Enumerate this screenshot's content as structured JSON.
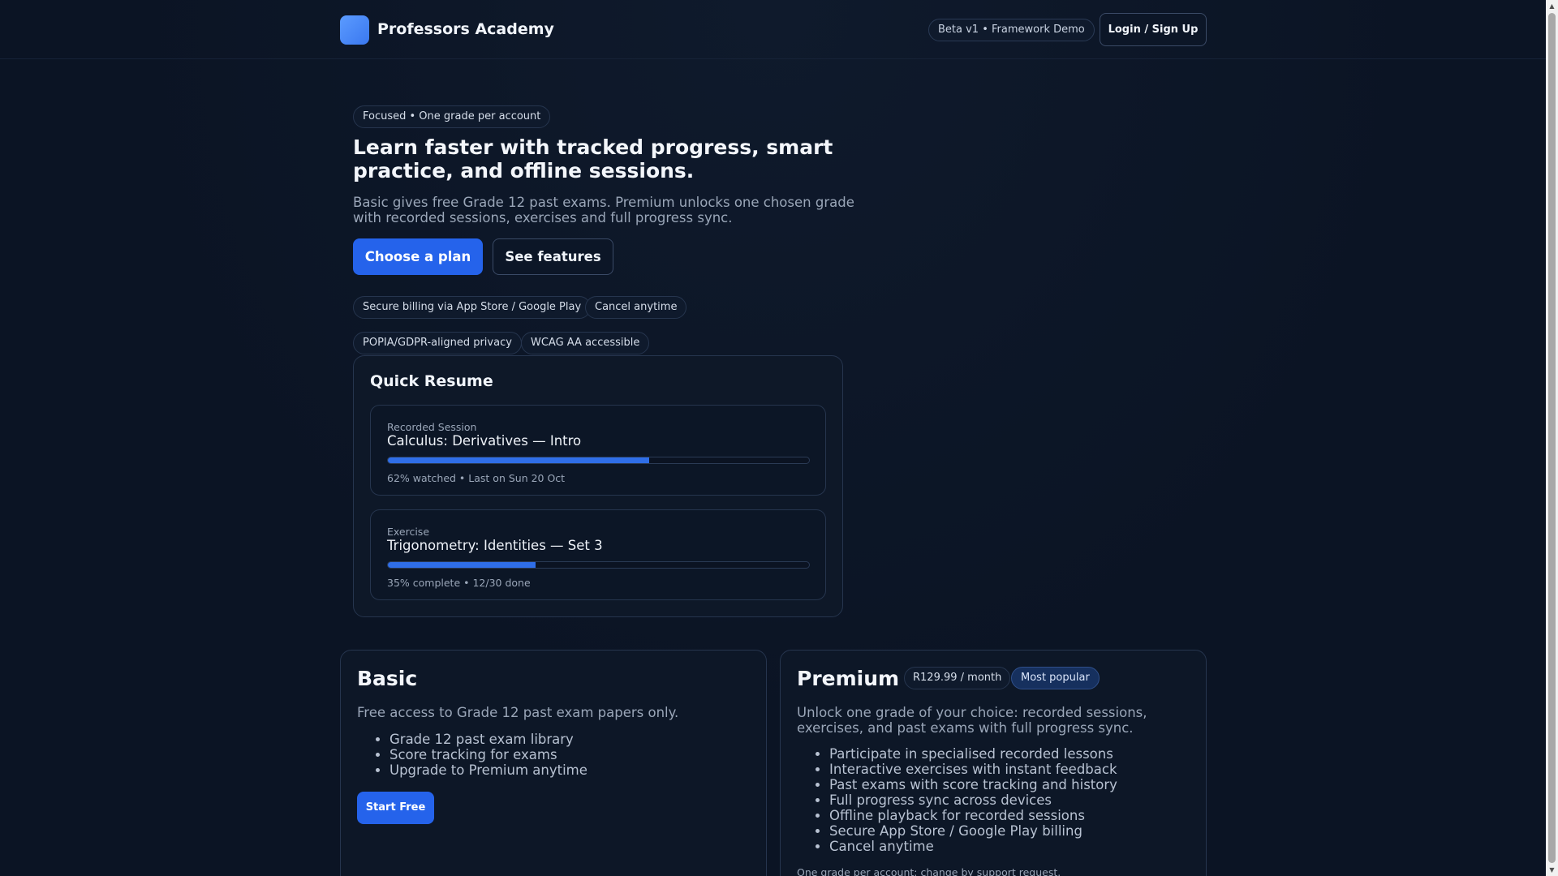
{
  "header": {
    "brand": "Professors Academy",
    "beta_badge": "Beta v1 • Framework Demo",
    "login_label": "Login / Sign Up"
  },
  "hero": {
    "eyebrow": "Focused • One grade per account",
    "title": "Learn faster with tracked progress, smart practice, and offline sessions.",
    "subtitle": "Basic gives free Grade 12 past exams. Premium unlocks one chosen grade with recorded sessions, exercises and full progress sync.",
    "primary_cta": "Choose a plan",
    "secondary_cta": "See features",
    "trust_pills": [
      "Secure billing via App Store / Google Play",
      "Cancel anytime",
      "POPIA/GDPR-aligned privacy",
      "WCAG AA accessible"
    ]
  },
  "quick_resume": {
    "title": "Quick Resume",
    "items": [
      {
        "kind": "Recorded Session",
        "name": "Calculus: Derivatives — Intro",
        "progress": 0.62,
        "meta": "62% watched • Last on Sun 20 Oct"
      },
      {
        "kind": "Exercise",
        "name": "Trigonometry: Identities — Set 3",
        "progress": 0.35,
        "meta": "35% complete • 12/30 done"
      }
    ]
  },
  "plans": {
    "basic": {
      "name": "Basic",
      "description": "Free access to Grade 12 past exam papers only.",
      "features": [
        "Grade 12 past exam library",
        "Score tracking for exams",
        "Upgrade to Premium anytime"
      ],
      "cta": "Start Free"
    },
    "premium": {
      "name": "Premium",
      "price": "R129.99 / month",
      "badge": "Most popular",
      "description": "Unlock one grade of your choice: recorded sessions, exercises, and past exams with full progress sync.",
      "features": [
        "Participate in specialised recorded lessons",
        "Interactive exercises with instant feedback",
        "Past exams with score tracking and history",
        "Full progress sync across devices",
        "Offline playback for recorded sessions",
        "Secure App Store / Google Play billing",
        "Cancel anytime"
      ],
      "fine_print": "One grade per account; change by support request."
    }
  },
  "colors": {
    "background": "#0b1424",
    "accent": "#2563eb",
    "progress_fill": "#2f6ee8"
  }
}
